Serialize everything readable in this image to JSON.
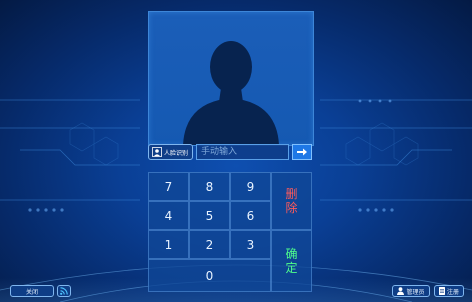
{
  "face_recognition": {
    "label": "人脸识别"
  },
  "manual_input": {
    "placeholder": "手动输入"
  },
  "keypad": {
    "keys": [
      "7",
      "8",
      "9",
      "4",
      "5",
      "6",
      "1",
      "2",
      "3",
      "0"
    ],
    "delete_label_top": "删",
    "delete_label_bottom": "除",
    "confirm_label_top": "确",
    "confirm_label_bottom": "定"
  },
  "bottom_bar": {
    "close_label": "关闭",
    "admin_label": "管理员",
    "register_label": "注册"
  },
  "colors": {
    "accent": "#1e78e6",
    "delete": "#ff5a5a",
    "confirm": "#4fff8c"
  }
}
